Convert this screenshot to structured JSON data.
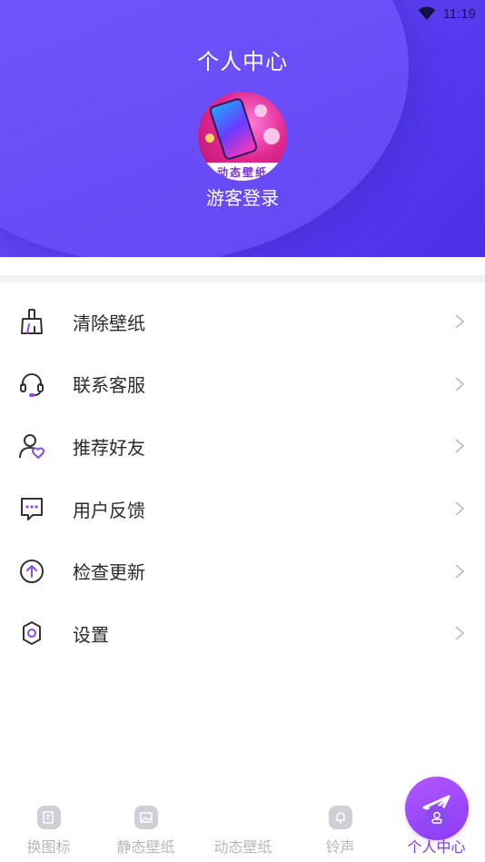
{
  "status_bar": {
    "time": "11:19",
    "icons": [
      "wifi-icon"
    ]
  },
  "header": {
    "title": "个人中心",
    "avatar_caption": "动态壁纸",
    "login_text": "游客登录",
    "gradient_colors": [
      "#6b4ff7",
      "#4a2fe6"
    ]
  },
  "menu": {
    "items": [
      {
        "label": "清除壁纸",
        "icon": "broom-icon"
      },
      {
        "label": "联系客服",
        "icon": "headset-icon"
      },
      {
        "label": "推荐好友",
        "icon": "user-heart-icon"
      },
      {
        "label": "用户反馈",
        "icon": "chat-bubble-icon"
      },
      {
        "label": "检查更新",
        "icon": "arrow-up-circle-icon"
      },
      {
        "label": "设置",
        "icon": "gear-icon"
      }
    ]
  },
  "tabbar": {
    "tabs": [
      {
        "label": "换图标",
        "icon": "edit-icon",
        "active": false
      },
      {
        "label": "静态壁纸",
        "icon": "image-icon",
        "active": false
      },
      {
        "label": "动态壁纸",
        "icon": "paper-plane-icon",
        "active": false
      },
      {
        "label": "铃声",
        "icon": "bell-icon",
        "active": false
      },
      {
        "label": "个人中心",
        "icon": "user-icon",
        "active": true
      }
    ],
    "accent_color": "#7a3ef0",
    "inactive_color": "#b6b6bd"
  }
}
